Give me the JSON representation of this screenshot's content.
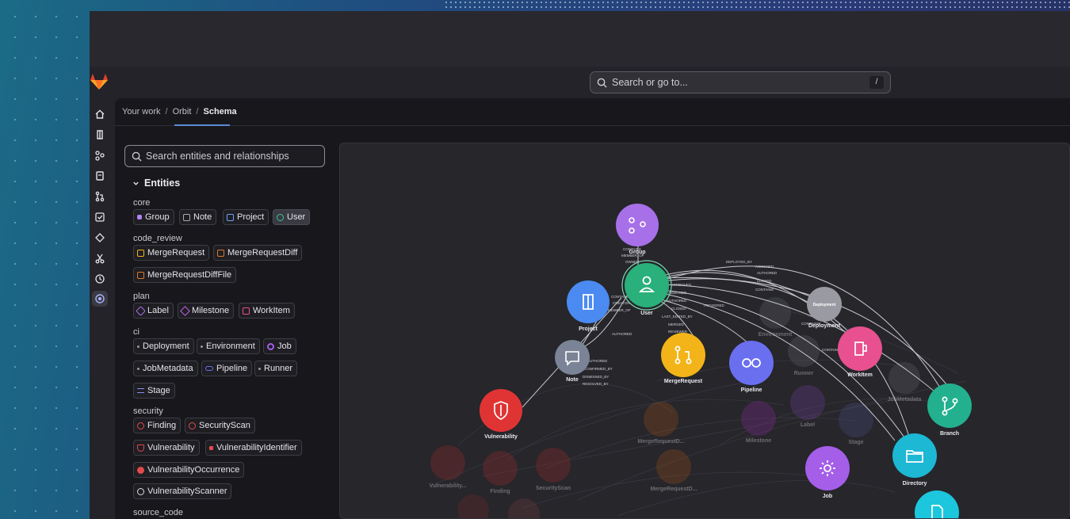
{
  "search": {
    "placeholder": "Search or go to...",
    "shortcut": "/"
  },
  "breadcrumb": {
    "items": [
      "Your work",
      "Orbit"
    ],
    "current": "Schema"
  },
  "sidebar": {
    "search_placeholder": "Search entities and relationships",
    "entities_heading": "Entities",
    "groups": [
      {
        "name": "core",
        "items": [
          "Group",
          "Note",
          "Project",
          "User"
        ]
      },
      {
        "name": "code_review",
        "items": [
          "MergeRequest",
          "MergeRequestDiff",
          "MergeRequestDiffFile"
        ]
      },
      {
        "name": "plan",
        "items": [
          "Label",
          "Milestone",
          "WorkItem"
        ]
      },
      {
        "name": "ci",
        "items": [
          "Deployment",
          "Environment",
          "Job",
          "JobMetadata",
          "Pipeline",
          "Runner",
          "Stage"
        ]
      },
      {
        "name": "security",
        "items": [
          "Finding",
          "SecurityScan",
          "Vulnerability",
          "VulnerabilityIdentifier",
          "VulnerabilityOccurrence",
          "VulnerabilityScanner"
        ]
      },
      {
        "name": "source_code",
        "items": []
      }
    ]
  },
  "graph": {
    "nodes": [
      {
        "label": "Group",
        "color": "#a770e8",
        "icon": "group-icon"
      },
      {
        "label": "User",
        "color": "#2ab07a",
        "icon": "user-icon"
      },
      {
        "label": "Project",
        "color": "#4b8af0",
        "icon": "project-icon"
      },
      {
        "label": "Note",
        "color": "#7a8496",
        "icon": "note-icon"
      },
      {
        "label": "MergeRequest",
        "color": "#f2b418",
        "icon": "merge-request-icon"
      },
      {
        "label": "Pipeline",
        "color": "#6a6ff0",
        "icon": "pipeline-icon"
      },
      {
        "label": "Deployment",
        "color": "#9a9aa2",
        "icon": "deployment-icon"
      },
      {
        "label": "WorkItem",
        "color": "#e8508f",
        "icon": "work-item-icon"
      },
      {
        "label": "Vulnerability",
        "color": "#e03434",
        "icon": "shield-icon"
      },
      {
        "label": "Branch",
        "color": "#23b08e",
        "icon": "branch-icon"
      },
      {
        "label": "Directory",
        "color": "#1cb8d4",
        "icon": "folder-icon"
      },
      {
        "label": "Job",
        "color": "#a45ee8",
        "icon": "gear-icon"
      },
      {
        "label": "",
        "color": "#1cc6dc",
        "icon": "file-icon"
      }
    ],
    "faded_nodes": [
      "Vulnerability...",
      "Finding",
      "SecurityScan",
      "MergeRequestD...",
      "MergeRequestD...",
      "Milestone",
      "Label",
      "Stage",
      "Environment",
      "Runner",
      "JobMetadata"
    ],
    "edge_labels": [
      "CONTAINS",
      "MEMBER_OF",
      "OWNED",
      "DEPLOYED_BY",
      "ASSIGNED",
      "AUTHORED",
      "CLOSED",
      "CONTAINS",
      "APPROVED",
      "ASSIGNED",
      "AUTHORED",
      "CLOSED",
      "LAST_EDITED_BY",
      "MERGED",
      "REVIEWER",
      "TRIGGERED",
      "CONTAINS",
      "CREATOR",
      "MEMBER_OF",
      "AUTHORED",
      "AUTHORED",
      "CONFIRMED_BY",
      "DISMISSED_BY",
      "RESOLVED_BY",
      "CONTAINS",
      "CONTAINS"
    ]
  }
}
